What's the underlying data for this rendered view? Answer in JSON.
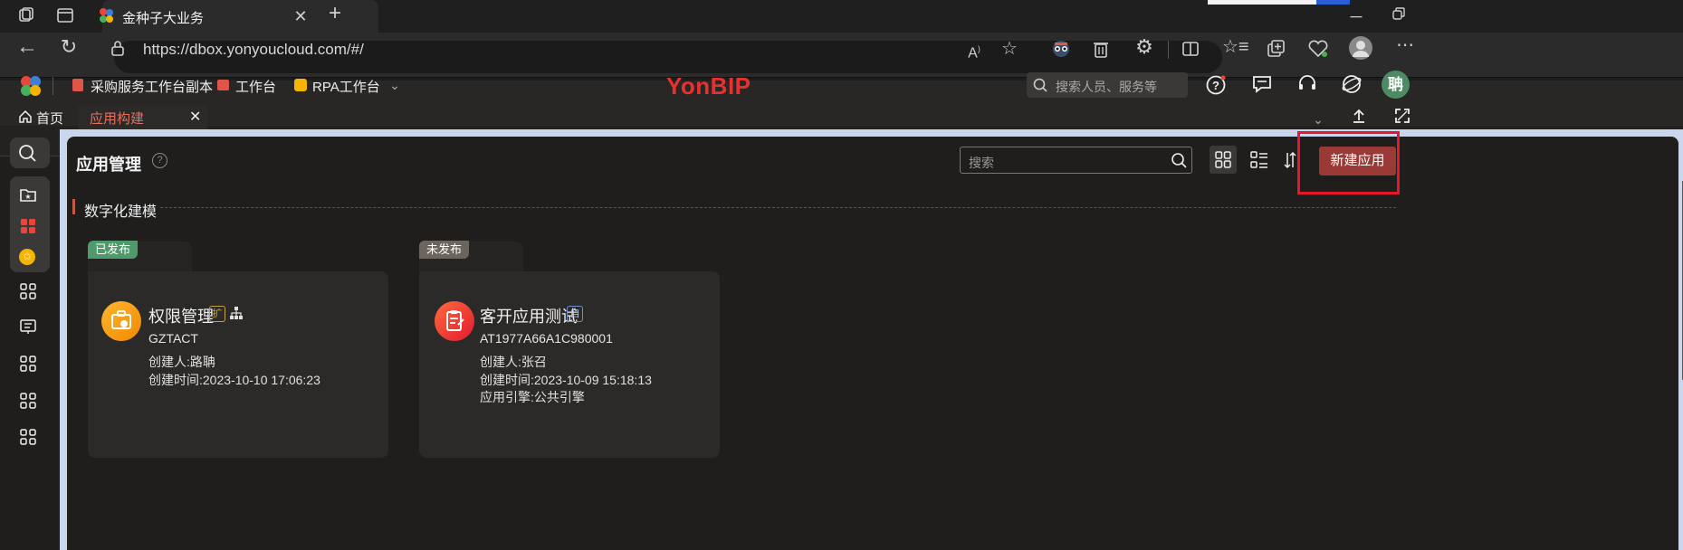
{
  "browser": {
    "tab_title": "金种子大业务",
    "url": "https://dbox.yonyoucloud.com/#/",
    "icons": [
      "workspaces-icon",
      "tab-actions-icon",
      "close-icon",
      "new-tab-icon",
      "back-icon",
      "refresh-icon",
      "lock-icon",
      "read-aloud-icon",
      "favorite-star-icon",
      "extension-icon",
      "trash-icon",
      "extensions-puzzle-icon",
      "split-screen-icon",
      "favorites-icon",
      "collections-icon",
      "health-icon",
      "profile-icon",
      "more-icon"
    ]
  },
  "app_header": {
    "shortcuts": [
      {
        "label": "采购服务工作台副本",
        "icon": "document-icon",
        "color": "#e0554a"
      },
      {
        "label": "工作台",
        "icon": "workbench-icon",
        "color": "#e0554a"
      },
      {
        "label": "RPA工作台",
        "icon": "rpa-icon",
        "color": "#f5b400"
      }
    ],
    "brand": "YonBIP",
    "brand_color": "#e8312f",
    "search_placeholder": "搜索人员、服务等",
    "avatar_text": "聃",
    "avatar_color": "#4e8a63"
  },
  "tabs": {
    "home": "首页",
    "active": "应用构建",
    "active_color": "#e6705f"
  },
  "page": {
    "title": "应用管理",
    "search_placeholder": "搜索",
    "new_button": "新建应用",
    "new_button_color": "#9a3a36",
    "section_title": "数字化建模",
    "section_color": "#c25a4a"
  },
  "cards": [
    {
      "status": "已发布",
      "status_color": "#4f9a6b",
      "title": "权限管理",
      "badge": "扩",
      "code": "GZTACT",
      "creator": "创建人:路聃",
      "created": "创建时间:2023-10-10 17:06:23",
      "engine": ""
    },
    {
      "status": "未发布",
      "status_color": "#6b655d",
      "title": "客开应用测试",
      "badge": "自",
      "code": "AT1977A66A1C980001",
      "creator": "创建人:张召",
      "created": "创建时间:2023-10-09 15:18:13",
      "engine": "应用引擎:公共引擎"
    }
  ]
}
